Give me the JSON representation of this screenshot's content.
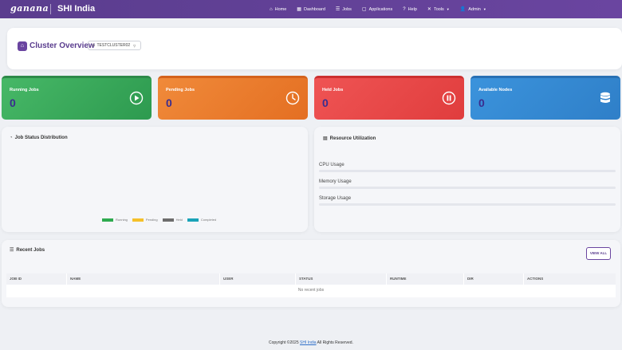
{
  "brand": {
    "logo": "ganana",
    "name": "SHI India"
  },
  "nav": {
    "items": [
      {
        "label": "Home",
        "icon": "home-icon",
        "glyph": "⌂"
      },
      {
        "label": "Dashboard",
        "icon": "dashboard-icon",
        "glyph": "▦"
      },
      {
        "label": "Jobs",
        "icon": "list-icon",
        "glyph": "☰"
      },
      {
        "label": "Applications",
        "icon": "applications-icon",
        "glyph": "▢"
      },
      {
        "label": "Help",
        "icon": "help-icon",
        "glyph": "?"
      },
      {
        "label": "Tools",
        "icon": "tools-icon",
        "glyph": "✕"
      },
      {
        "label": "Admin",
        "icon": "user-icon",
        "glyph": "👤"
      }
    ]
  },
  "cluster": {
    "title": "Cluster Overview",
    "selected": "TESTCLUSTER02"
  },
  "stats": [
    {
      "label": "Running Jobs",
      "value": "0",
      "icon": "play-circle-icon",
      "color": "#3ba95a"
    },
    {
      "label": "Pending Jobs",
      "value": "0",
      "icon": "clock-icon",
      "color": "#eb7c2e"
    },
    {
      "label": "Held Jobs",
      "value": "0",
      "icon": "pause-circle-icon",
      "color": "#e84848"
    },
    {
      "label": "Available Nodes",
      "value": "0",
      "icon": "database-icon",
      "color": "#3589d2"
    }
  ],
  "job_status": {
    "title": "Job Status Distribution",
    "legend": [
      {
        "label": "Running",
        "color": "#2eaa4f"
      },
      {
        "label": "Pending",
        "color": "#f5c02a"
      },
      {
        "label": "Held",
        "color": "#6d6d6d"
      },
      {
        "label": "Completed",
        "color": "#1aa3b8"
      }
    ]
  },
  "resources": {
    "title": "Resource Utilization",
    "rows": [
      {
        "label": "CPU Usage"
      },
      {
        "label": "Memory Usage"
      },
      {
        "label": "Storage Usage"
      }
    ]
  },
  "recent_jobs": {
    "title": "Recent Jobs",
    "view_all": "VIEW ALL",
    "columns": [
      "JOB ID",
      "NAME",
      "USER",
      "STATUS",
      "RUNTIME",
      "DIR",
      "ACTIONS"
    ],
    "empty": "No recent jobs"
  },
  "footer": {
    "prefix": "Copyright ©2025 ",
    "link": "SHI India",
    "suffix": " All Rights Reserved."
  }
}
